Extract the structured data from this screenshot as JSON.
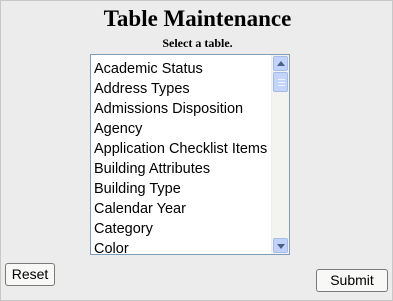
{
  "form": {
    "title": "Table Maintenance",
    "instruction": "Select a table.",
    "tables": [
      "Academic Status",
      "Address Types",
      "Admissions Disposition",
      "Agency",
      "Application Checklist Items",
      "Building Attributes",
      "Building Type",
      "Calendar Year",
      "Category",
      "Color"
    ],
    "reset_label": "Reset",
    "submit_label": "Submit"
  },
  "icons": {
    "scroll_up": "scroll-up-arrow",
    "scroll_down": "scroll-down-arrow"
  },
  "colors": {
    "background": "#ececec",
    "list_border": "#7f9db9",
    "scrollbar_button": "#c1d3fb",
    "scrollbar_arrow": "#4d6185"
  }
}
